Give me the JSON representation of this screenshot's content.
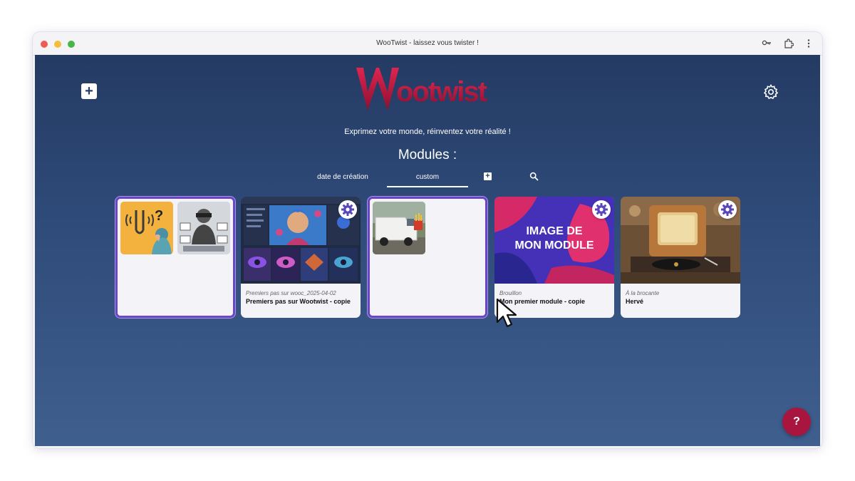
{
  "window": {
    "title": "WooTwist - laissez vous twister !"
  },
  "header": {
    "logo_text": "Wootwist",
    "tagline": "Exprimez votre monde, réinventez votre réalité !",
    "section_title": "Modules :"
  },
  "sort": {
    "date_label": "date de création",
    "custom_label": "custom",
    "add_label": "+"
  },
  "toolbar": {
    "add_label": "+"
  },
  "cards": [
    {
      "type": "folder",
      "status": "",
      "title": ""
    },
    {
      "type": "module",
      "status": "Premiers pas sur wooc_2025-04-02",
      "title": "Premiers pas sur Wootwist - copie"
    },
    {
      "type": "folder",
      "status": "",
      "title": ""
    },
    {
      "type": "module",
      "status": "Brouillon",
      "title": "Mon premier module - copie",
      "image_text_1": "IMAGE DE",
      "image_text_2": "MON MODULE"
    },
    {
      "type": "module",
      "status": "À la brocante",
      "title": "Hervé"
    }
  ],
  "help": {
    "label": "?"
  },
  "colors": {
    "brand": "#c4173f",
    "folder_border": "#6a45c7",
    "background_top": "#243b63",
    "background_bottom": "#3f5f8f"
  }
}
